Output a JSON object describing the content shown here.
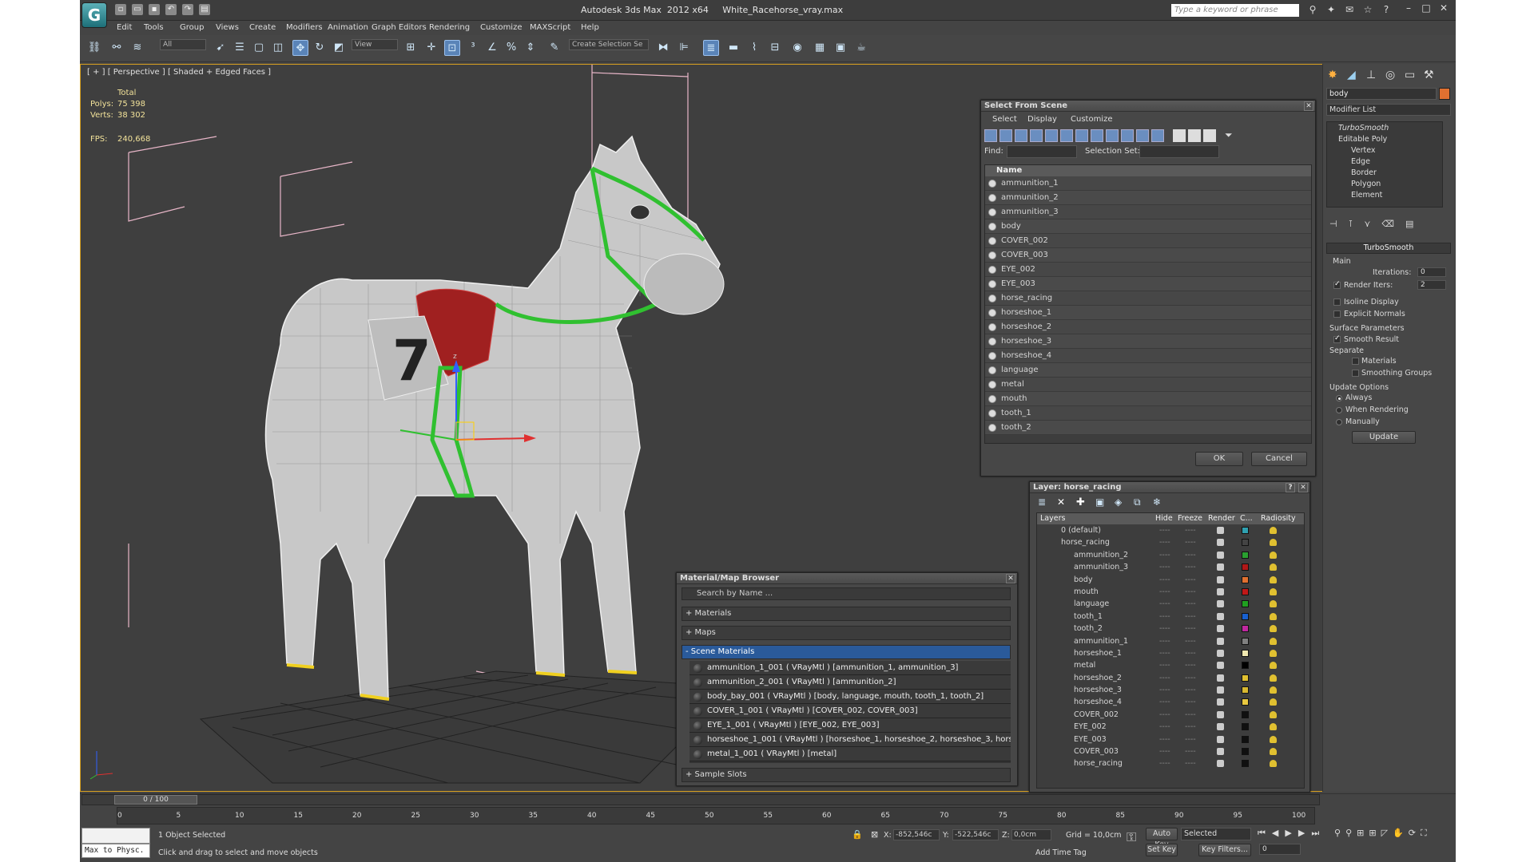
{
  "app": {
    "title": "Autodesk 3ds Max  2012 x64     White_Racehorse_vray.max",
    "logo": "3ds-max-logo",
    "search_placeholder": "Type a keyword or phrase"
  },
  "menu": [
    "Edit",
    "Tools",
    "Group",
    "Views",
    "Create",
    "Modifiers",
    "Animation",
    "Graph Editors",
    "Rendering",
    "Customize",
    "MAXScript",
    "Help"
  ],
  "toolbar": {
    "selection_filter": "All",
    "ref_coord": "View",
    "named_selection": "Create Selection Se"
  },
  "viewport": {
    "label": "[ + ] [ Perspective ] [ Shaded + Edged Faces ]",
    "stats": {
      "total_label": "Total",
      "polys_label": "Polys:",
      "polys_value": "75 398",
      "verts_label": "Verts:",
      "verts_value": "38 302",
      "fps_label": "FPS:",
      "fps_value": "240,668"
    },
    "axis": {
      "x": "x",
      "y": "y",
      "z": "z"
    }
  },
  "select_scene": {
    "title": "Select From Scene",
    "menu": [
      "Select",
      "Display",
      "Customize"
    ],
    "find_label": "Find:",
    "selection_set_label": "Selection Set:",
    "column_name": "Name",
    "items": [
      "ammunition_1",
      "ammunition_2",
      "ammunition_3",
      "body",
      "COVER_002",
      "COVER_003",
      "EYE_002",
      "EYE_003",
      "horse_racing",
      "horseshoe_1",
      "horseshoe_2",
      "horseshoe_3",
      "horseshoe_4",
      "language",
      "metal",
      "mouth",
      "tooth_1",
      "tooth_2"
    ],
    "ok": "OK",
    "cancel": "Cancel"
  },
  "layer_dialog": {
    "title": "Layer: horse_racing",
    "help": "?",
    "columns": {
      "layers": "Layers",
      "hide": "Hide",
      "freeze": "Freeze",
      "render": "Render",
      "color": "C...",
      "radiosity": "Radiosity"
    },
    "rows": [
      {
        "name": "0 (default)",
        "color": "#2fa0b0",
        "level": 0
      },
      {
        "name": "horse_racing",
        "color": "#444444",
        "level": 0
      },
      {
        "name": "ammunition_2",
        "color": "#2aa030",
        "level": 1
      },
      {
        "name": "ammunition_3",
        "color": "#b01818",
        "level": 1
      },
      {
        "name": "body",
        "color": "#e07030",
        "level": 1
      },
      {
        "name": "mouth",
        "color": "#c01818",
        "level": 1
      },
      {
        "name": "language",
        "color": "#20a020",
        "level": 1
      },
      {
        "name": "tooth_1",
        "color": "#1860d0",
        "level": 1
      },
      {
        "name": "tooth_2",
        "color": "#c028a0",
        "level": 1
      },
      {
        "name": "ammunition_1",
        "color": "#808080",
        "level": 1
      },
      {
        "name": "horseshoe_1",
        "color": "#f0e8b0",
        "level": 1
      },
      {
        "name": "metal",
        "color": "#000000",
        "level": 1
      },
      {
        "name": "horseshoe_2",
        "color": "#e0c030",
        "level": 1
      },
      {
        "name": "horseshoe_3",
        "color": "#d8b830",
        "level": 1
      },
      {
        "name": "horseshoe_4",
        "color": "#e8c840",
        "level": 1
      },
      {
        "name": "COVER_002",
        "color": "#101010",
        "level": 1
      },
      {
        "name": "EYE_002",
        "color": "#101010",
        "level": 1
      },
      {
        "name": "EYE_003",
        "color": "#101010",
        "level": 1
      },
      {
        "name": "COVER_003",
        "color": "#101010",
        "level": 1
      },
      {
        "name": "horse_racing",
        "color": "#101010",
        "level": 1
      }
    ],
    "hide_mark": "----",
    "freeze_mark": "----"
  },
  "material_browser": {
    "title": "Material/Map Browser",
    "search_placeholder": "Search by Name ...",
    "sections": {
      "materials": "+ Materials",
      "maps": "+ Maps",
      "scene": "- Scene Materials",
      "sample": "+ Sample Slots"
    },
    "scene_items": [
      "ammunition_1_001  ( VRayMtl ) [ammunition_1, ammunition_3]",
      "ammunition_2_001  ( VRayMtl ) [ammunition_2]",
      "body_bay_001  ( VRayMtl ) [body, language, mouth, tooth_1, tooth_2]",
      "COVER_1_001  ( VRayMtl ) [COVER_002, COVER_003]",
      "EYE_1_001  ( VRayMtl ) [EYE_002, EYE_003]",
      "horseshoe_1_001  ( VRayMtl ) [horseshoe_1, horseshoe_2, horseshoe_3, horses...",
      "metal_1_001  ( VRayMtl ) [metal]"
    ]
  },
  "command_panel": {
    "object_name": "body",
    "object_color": "#e07030",
    "modifier_list": "Modifier List",
    "stack": {
      "turbosmooth": "TurboSmooth",
      "editable_poly": "Editable Poly",
      "subs": [
        "Vertex",
        "Edge",
        "Border",
        "Polygon",
        "Element"
      ]
    },
    "rollout_title": "TurboSmooth",
    "main": "Main",
    "iterations_label": "Iterations:",
    "iterations_value": "0",
    "render_iters_label": "Render Iters:",
    "render_iters_value": "2",
    "isoline": "Isoline Display",
    "explicit_normals": "Explicit Normals",
    "surface_params": "Surface Parameters",
    "smooth_result": "Smooth Result",
    "separate": "Separate",
    "materials": "Materials",
    "smoothing_groups": "Smoothing Groups",
    "update_options": "Update Options",
    "always": "Always",
    "when_rendering": "When Rendering",
    "manually": "Manually",
    "update": "Update"
  },
  "timeline": {
    "slider": "0 / 100",
    "ticks": [
      "0",
      "5",
      "10",
      "15",
      "20",
      "25",
      "30",
      "35",
      "40",
      "45",
      "50",
      "55",
      "60",
      "65",
      "70",
      "75",
      "80",
      "85",
      "90",
      "95",
      "100"
    ]
  },
  "status": {
    "script_label": "Max to Physc.",
    "selected": "1 Object Selected",
    "prompt": "Click and drag to select and move objects",
    "x_label": "X:",
    "x_value": "-852,546c",
    "y_label": "Y:",
    "y_value": "-522,546c",
    "z_label": "Z:",
    "z_value": "0,0cm",
    "grid": "Grid = 10,0cm",
    "autokey": "Auto Key",
    "setkey": "Set Key",
    "key_mode": "Selected",
    "key_filters": "Key Filters...",
    "add_time_tag": "Add Time Tag",
    "frame": "0"
  }
}
